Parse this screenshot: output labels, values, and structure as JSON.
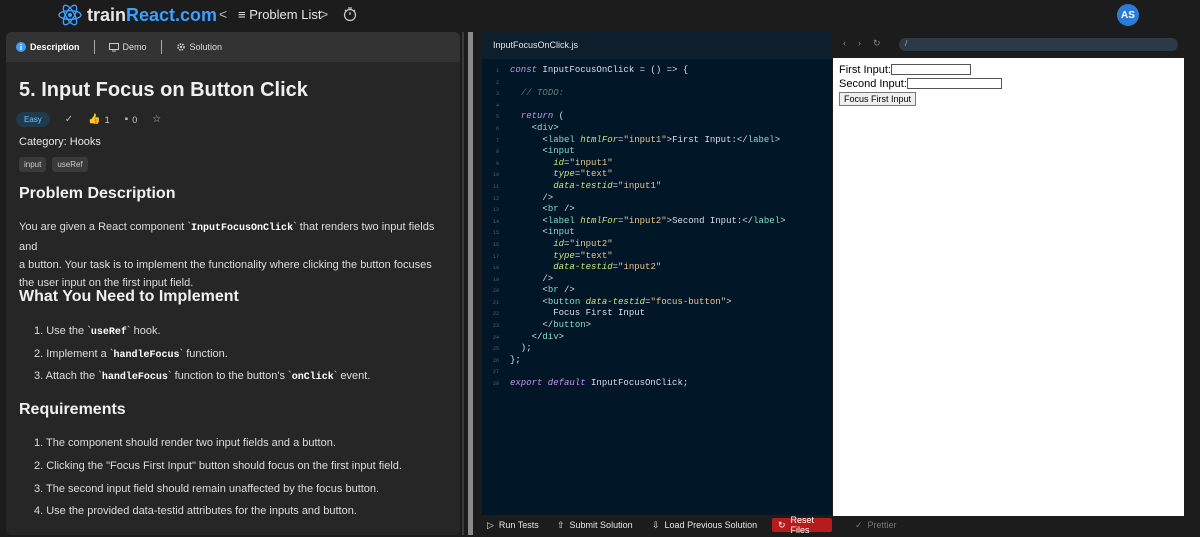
{
  "brand": {
    "part1": "train",
    "part2": "React.com"
  },
  "nav": {
    "prev": "<",
    "list_label": "≡ Problem List",
    "next": ">"
  },
  "user": {
    "initials": "AS"
  },
  "tabs": [
    {
      "label": "Description"
    },
    {
      "label": "Demo"
    },
    {
      "label": "Solution"
    }
  ],
  "problem": {
    "title": "5. Input Focus on Button Click",
    "difficulty": "Easy",
    "likes": "1",
    "comments": "0",
    "category": "Category: Hooks",
    "tags": [
      "input",
      "useRef"
    ],
    "desc_heading": "Problem Description",
    "desc_1": "You are given a React component `",
    "desc_code": "InputFocusOnClick",
    "desc_2": "` that renders two input fields and",
    "desc_3": "a button. Your task is to implement the functionality where clicking the button focuses",
    "desc_4": "the user input on the first input field.",
    "impl_heading": "What You Need to Implement",
    "impl_items": [
      {
        "pre": "1. Use the `",
        "code": "useRef",
        "post": "` hook."
      },
      {
        "pre": "2. Implement a `",
        "code": "handleFocus",
        "post": "` function."
      },
      {
        "pre": "3. Attach the `",
        "code": "handleFocus",
        "mid": "` function to the button's `",
        "code2": "onClick",
        "post": "` event."
      }
    ],
    "req_heading": "Requirements",
    "req_items": [
      "1. The component should render two input fields and a button.",
      "2. Clicking the \"Focus First Input\" button should focus on the first input field.",
      "3. The second input field should remain unaffected by the focus button.",
      "4. Use the provided data-testid attributes for the inputs and button."
    ]
  },
  "editor": {
    "filename": "InputFocusOnClick.js",
    "line_numbers": [
      "1",
      "2",
      "3",
      "4",
      "5",
      "6",
      "7",
      "8",
      "9",
      "10",
      "11",
      "12",
      "13",
      "14",
      "15",
      "16",
      "17",
      "18",
      "19",
      "20",
      "21",
      "22",
      "23",
      "24",
      "25",
      "26",
      "27",
      "28"
    ]
  },
  "actions": {
    "run": "Run Tests",
    "submit": "Submit Solution",
    "load": "Load Previous Solution",
    "reset": "Reset Files",
    "prettier": "Prettier"
  },
  "preview": {
    "url": "/",
    "first_label": "First Input:",
    "second_label": "Second Input:",
    "button": "Focus First Input"
  }
}
